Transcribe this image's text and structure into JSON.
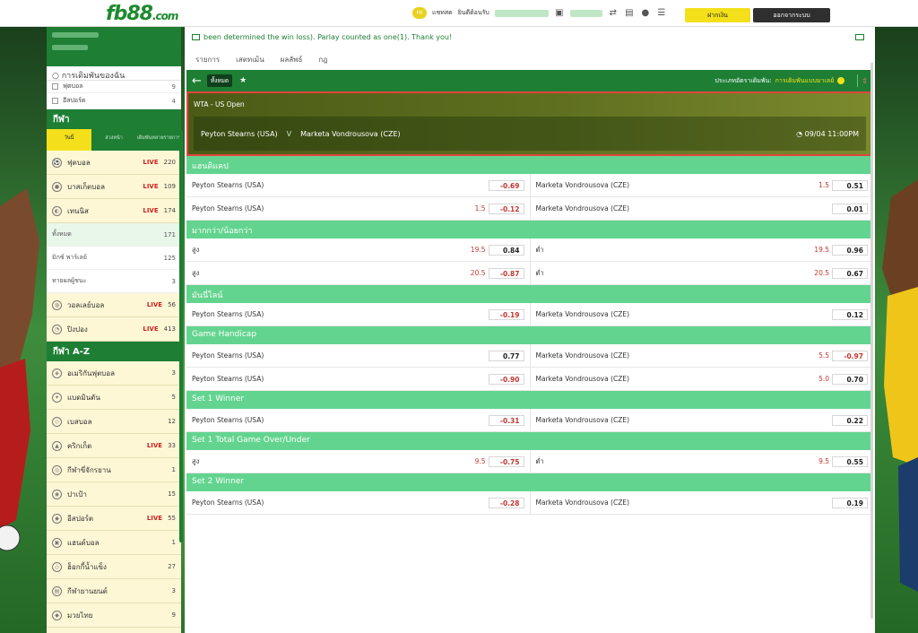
{
  "header": {
    "logo_main": "fb88",
    "logo_domain": ".com",
    "chat_label": "แชทสด",
    "welcome_label": "ยินดีต้อนรับ",
    "deposit_button": "ฝากเงิน",
    "logout_button": "ออกจากระบบ"
  },
  "sidebar": {
    "my_bets": "การเดิมพันของฉัน",
    "bet_rows": [
      {
        "label": "ฟุตบอล",
        "count": "9"
      },
      {
        "label": "อีสปอร์ต",
        "count": "4"
      }
    ],
    "sports_heading": "กีฬา",
    "tabs": [
      "วันนี้",
      "ล่วงหน้า",
      "เดิมพันหลายรายการ"
    ],
    "sports": [
      {
        "label": "ฟุตบอล",
        "live": "LIVE",
        "count": "220",
        "icon": "soccer-icon"
      },
      {
        "label": "บาสเก็ตบอล",
        "live": "LIVE",
        "count": "109",
        "icon": "basketball-icon"
      },
      {
        "label": "เทนนิส",
        "live": "LIVE",
        "count": "174",
        "icon": "tennis-icon"
      }
    ],
    "tennis_subs": [
      {
        "label": "ทั้งหมด",
        "count": "171"
      },
      {
        "label": "มิกซ์ พาร์เลย์",
        "count": "125"
      },
      {
        "label": "ทายผลผู้ชนะ",
        "count": "3"
      }
    ],
    "sports2": [
      {
        "label": "วอลเลย์บอล",
        "live": "LIVE",
        "count": "56",
        "icon": "volleyball-icon"
      },
      {
        "label": "ปิงปอง",
        "live": "LIVE",
        "count": "413",
        "icon": "table-tennis-icon"
      }
    ],
    "az_heading": "กีฬา A-Z",
    "az": [
      {
        "label": "อเมริกันฟุตบอล",
        "live": "",
        "count": "3",
        "icon": "american-football-icon"
      },
      {
        "label": "แบดมินตัน",
        "live": "",
        "count": "5",
        "icon": "badminton-icon"
      },
      {
        "label": "เบสบอล",
        "live": "",
        "count": "12",
        "icon": "baseball-icon"
      },
      {
        "label": "คริกเก็ต",
        "live": "LIVE",
        "count": "33",
        "icon": "cricket-icon"
      },
      {
        "label": "กีฬาขี่จักรยาน",
        "live": "",
        "count": "1",
        "icon": "cycling-icon"
      },
      {
        "label": "ปาเป้า",
        "live": "",
        "count": "15",
        "icon": "darts-icon"
      },
      {
        "label": "อีสปอร์ต",
        "live": "LIVE",
        "count": "55",
        "icon": "esports-icon"
      },
      {
        "label": "แฮนด์บอล",
        "live": "",
        "count": "1",
        "icon": "handball-icon"
      },
      {
        "label": "ฮ็อกกี้น้ำแข็ง",
        "live": "",
        "count": "27",
        "icon": "ice-hockey-icon"
      },
      {
        "label": "กีฬายานยนต์",
        "live": "",
        "count": "3",
        "icon": "motorsport-icon"
      },
      {
        "label": "มวยไทย",
        "live": "",
        "count": "9",
        "icon": "muay-thai-icon"
      }
    ]
  },
  "main": {
    "ticker": "been determined the win loss). Parlay counted as one(1). Thank you!",
    "subnav": [
      "รายการ",
      "เสตทเม้น",
      "ผลลัพธ์",
      "กฎ"
    ],
    "filter_all": "ทั้งหมด",
    "odds_type_label": "ประเภทอัตราเดิมพัน:",
    "odds_type_value": "การเดิมพันแบบมาเลย์",
    "league": "WTA - US Open",
    "home": "Peyton Stearns (USA)",
    "vs": "V",
    "away": "Marketa Vondrousova (CZE)",
    "kickoff": "09/04 11:00PM",
    "markets": [
      {
        "title": "แฮนดิแคป",
        "rows": [
          {
            "l_name": "Peyton Stearns (USA)",
            "l_hc": "",
            "l_odd": "-0.69",
            "r_name": "Marketa Vondrousova (CZE)",
            "r_hc": "1.5",
            "r_odd": "0.51"
          },
          {
            "l_name": "Peyton Stearns (USA)",
            "l_hc": "1.5",
            "l_odd": "-0.12",
            "r_name": "Marketa Vondrousova (CZE)",
            "r_hc": "",
            "r_odd": "0.01"
          }
        ]
      },
      {
        "title": "มากกว่า/น้อยกว่า",
        "rows": [
          {
            "l_name": "สูง",
            "l_hc": "19.5",
            "l_odd": "0.84",
            "r_name": "ต่ำ",
            "r_hc": "19.5",
            "r_odd": "0.96"
          },
          {
            "l_name": "สูง",
            "l_hc": "20.5",
            "l_odd": "-0.87",
            "r_name": "ต่ำ",
            "r_hc": "20.5",
            "r_odd": "0.67"
          }
        ]
      },
      {
        "title": "มันนี่ไลน์",
        "rows": [
          {
            "l_name": "Peyton Stearns (USA)",
            "l_hc": "",
            "l_odd": "-0.19",
            "r_name": "Marketa Vondrousova (CZE)",
            "r_hc": "",
            "r_odd": "0.12"
          }
        ]
      },
      {
        "title": "Game Handicap",
        "rows": [
          {
            "l_name": "Peyton Stearns (USA)",
            "l_hc": "",
            "l_odd": "0.77",
            "r_name": "Marketa Vondrousova (CZE)",
            "r_hc": "5.5",
            "r_odd": "-0.97"
          },
          {
            "l_name": "Peyton Stearns (USA)",
            "l_hc": "",
            "l_odd": "-0.90",
            "r_name": "Marketa Vondrousova (CZE)",
            "r_hc": "5.0",
            "r_odd": "0.70"
          }
        ]
      },
      {
        "title": "Set 1 Winner",
        "rows": [
          {
            "l_name": "Peyton Stearns (USA)",
            "l_hc": "",
            "l_odd": "-0.31",
            "r_name": "Marketa Vondrousova (CZE)",
            "r_hc": "",
            "r_odd": "0.22"
          }
        ]
      },
      {
        "title": "Set 1 Total Game Over/Under",
        "rows": [
          {
            "l_name": "สูง",
            "l_hc": "9.5",
            "l_odd": "-0.75",
            "r_name": "ต่ำ",
            "r_hc": "9.5",
            "r_odd": "0.55"
          }
        ]
      },
      {
        "title": "Set 2 Winner",
        "rows": [
          {
            "l_name": "Peyton Stearns (USA)",
            "l_hc": "",
            "l_odd": "-0.28",
            "r_name": "Marketa Vondrousova (CZE)",
            "r_hc": "",
            "r_odd": "0.19"
          }
        ]
      }
    ]
  },
  "colors": {
    "brand_green": "#1d7e34",
    "market_green": "#63d48f",
    "accent_yellow": "#f3e01a",
    "negative_red": "#c2362f",
    "live_red": "#d01f1f"
  }
}
